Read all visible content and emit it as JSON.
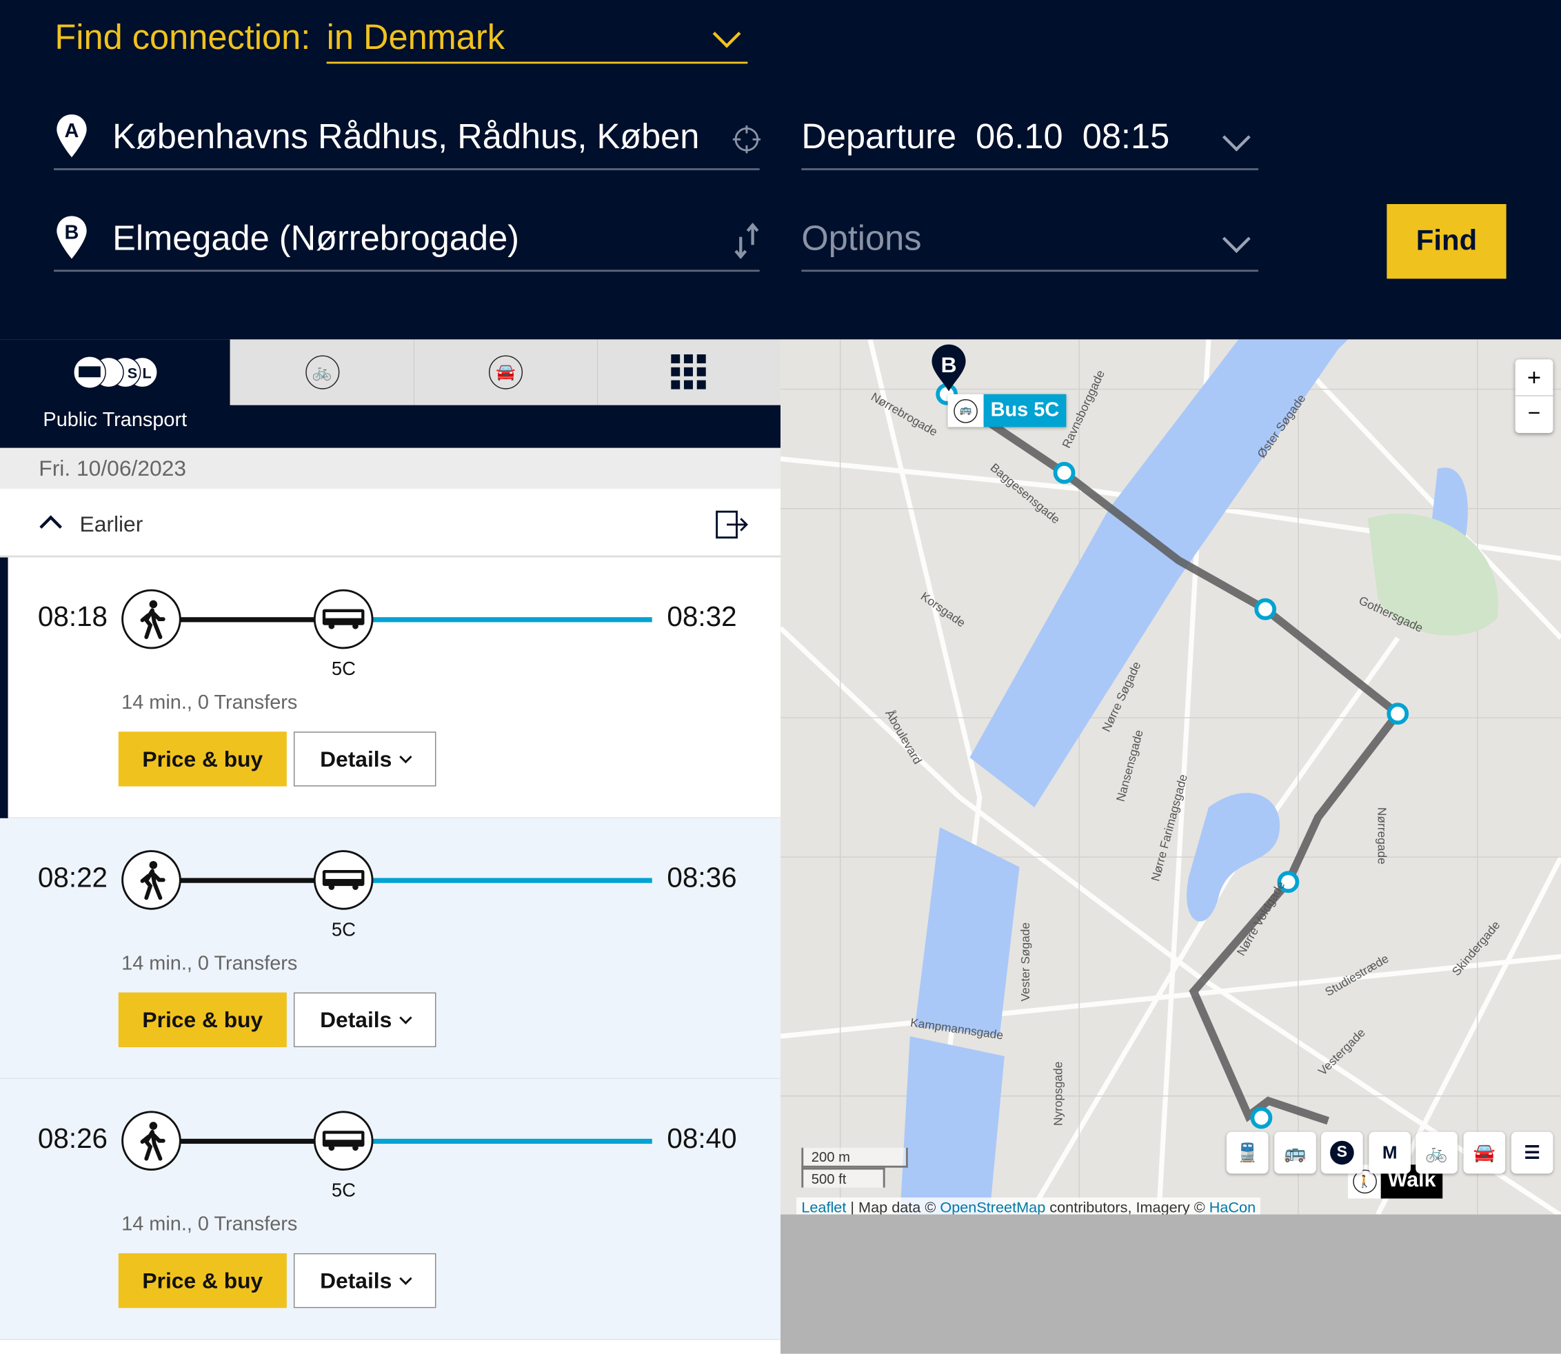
{
  "header": {
    "title": "Find connection:",
    "region": "in Denmark",
    "from": "Københavns Rådhus, Rådhus, Køben",
    "to": "Elmegade (Nørrebrogade)",
    "departure_label": "Departure",
    "date": "06.10",
    "time": "08:15",
    "options_placeholder": "Options",
    "find_label": "Find"
  },
  "tabs": [
    {
      "label": "Public Transport",
      "icon": "public-transport-icon",
      "active": true
    },
    {
      "icon": "bike-icon"
    },
    {
      "icon": "car-icon"
    },
    {
      "icon": "grid-icon"
    }
  ],
  "date": "Fri. 10/06/2023",
  "earlier_label": "Earlier",
  "connections": [
    {
      "dep": "08:18",
      "arr": "08:32",
      "line": "5C",
      "summary": "14 min., 0 Transfers",
      "price": "Price & buy",
      "details": "Details",
      "selected": true
    },
    {
      "dep": "08:22",
      "arr": "08:36",
      "line": "5C",
      "summary": "14 min., 0 Transfers",
      "price": "Price & buy",
      "details": "Details"
    },
    {
      "dep": "08:26",
      "arr": "08:40",
      "line": "5C",
      "summary": "14 min., 0 Transfers",
      "price": "Price & buy",
      "details": "Details"
    }
  ],
  "map": {
    "bus_label": "Bus 5C",
    "walk_label": "Walk",
    "marker_a": "A",
    "marker_b": "B",
    "zoom_in": "+",
    "zoom_out": "−",
    "scale_m": "200 m",
    "scale_ft": "500 ft",
    "attribution": {
      "leaflet": "Leaflet",
      "sep": " | Map data © ",
      "osm": "OpenStreetMap",
      "mid": " contributors, Imagery © ",
      "hacon": "HaCon"
    },
    "streets": [
      "Nørrebrogade",
      "Ravnsborggade",
      "Baggesensgade",
      "Korsgade",
      "Øster Søgade",
      "Nørre Søgade",
      "Gothersgade",
      "Nansensgade",
      "Nørre Farimagsgade",
      "Nørre Voldgade",
      "Vester Søgade",
      "Kampmannsgade",
      "Studiestræde",
      "Vestergade",
      "Nyropsgade",
      "Åboulevard",
      "Skindergade",
      "Nørregade"
    ],
    "mode_filters": [
      "train",
      "bus",
      "s-train",
      "metro",
      "bike",
      "car",
      "layers"
    ],
    "colors": {
      "route": "#5a5a5a",
      "stop": "#00a3d1",
      "water": "#aac8f7"
    }
  },
  "colors": {
    "navy": "#000f2b",
    "yellow": "#f0c21e",
    "bus_line": "#00a3d1"
  }
}
